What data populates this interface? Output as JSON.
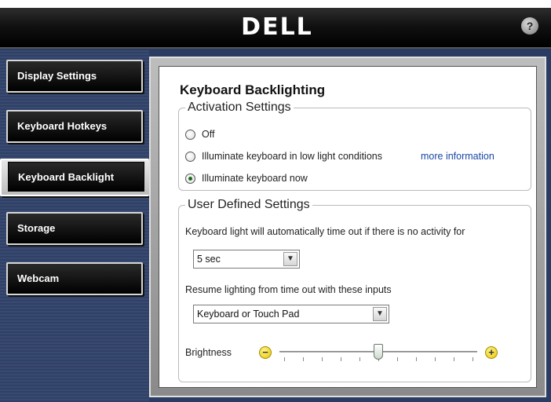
{
  "header": {
    "logo_text": "DELL",
    "help_label": "?"
  },
  "sidebar": {
    "items": [
      {
        "label": "Display Settings"
      },
      {
        "label": "Keyboard Hotkeys"
      },
      {
        "label": "Keyboard Backlight",
        "active": true
      },
      {
        "label": "Storage"
      },
      {
        "label": "Webcam"
      }
    ]
  },
  "main": {
    "title": "Keyboard Backlighting",
    "activation": {
      "legend": "Activation Settings",
      "options": [
        {
          "label": "Off",
          "checked": false
        },
        {
          "label": "Illuminate keyboard in low light conditions",
          "checked": false
        },
        {
          "label": "Illuminate keyboard now",
          "checked": true
        }
      ],
      "more_info_link": "more information"
    },
    "user_defined": {
      "legend": "User Defined Settings",
      "timeout_label": "Keyboard light will automatically time out if there is no activity for",
      "timeout_value": "5 sec",
      "resume_label": "Resume lighting from time out with these inputs",
      "resume_value": "Keyboard or Touch Pad",
      "brightness_label": "Brightness",
      "brightness_level_fraction": 0.5,
      "minus_label": "−",
      "plus_label": "+"
    }
  },
  "colors": {
    "accent_link": "#1a47a6",
    "sidebar_bg": "#2b3c63"
  }
}
